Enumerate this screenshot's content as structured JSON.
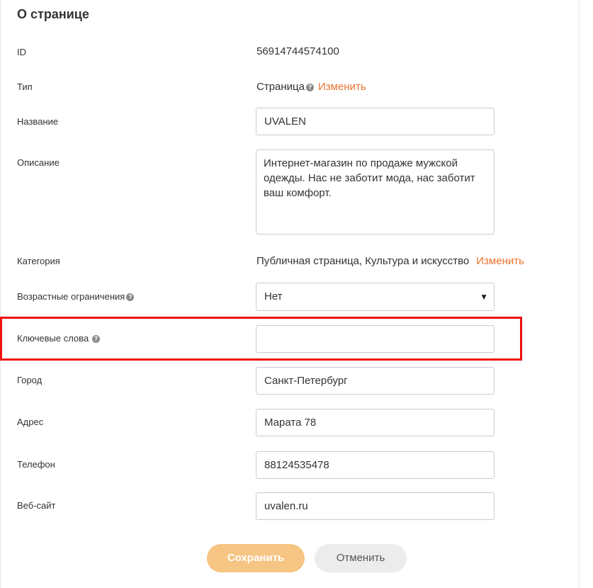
{
  "section_title": "О странице",
  "fields": {
    "id": {
      "label": "ID",
      "value": "56914744574100"
    },
    "type": {
      "label": "Тип",
      "value": "Страница",
      "change_link": "Изменить"
    },
    "name": {
      "label": "Название",
      "value": "UVALEN"
    },
    "description": {
      "label": "Описание",
      "value": "Интернет-магазин по продаже мужской одежды. Нас не заботит мода, нас заботит ваш комфорт."
    },
    "category": {
      "label": "Категория",
      "value": "Публичная страница, Культура и искусство",
      "change_link": "Изменить"
    },
    "age_restrictions": {
      "label": "Возрастные ограничения",
      "value": "Нет"
    },
    "keywords": {
      "label": "Ключевые слова",
      "value": ""
    },
    "city": {
      "label": "Город",
      "value": "Санкт-Петербург"
    },
    "address": {
      "label": "Адрес",
      "value": "Марата 78"
    },
    "phone": {
      "label": "Телефон",
      "value": "88124535478"
    },
    "website": {
      "label": "Веб-сайт",
      "value": "uvalen.ru"
    }
  },
  "buttons": {
    "save": "Сохранить",
    "cancel": "Отменить"
  },
  "colors": {
    "link": "#eb722e",
    "save_button": "#f6c483",
    "highlight_box": "#ee1111"
  },
  "icons": {
    "help": "question-circle-icon",
    "dropdown": "triangle-down-icon"
  }
}
